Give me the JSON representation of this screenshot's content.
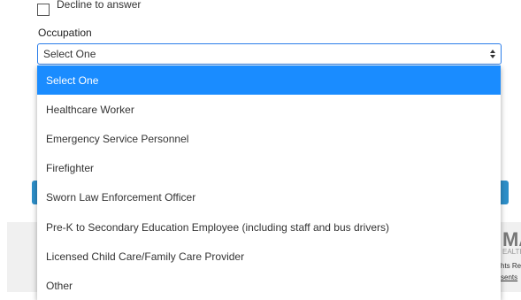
{
  "decline_checkbox": {
    "label": "Decline to answer"
  },
  "occupation": {
    "label": "Occupation",
    "selected_value": "Select One",
    "options": [
      {
        "label": "Select One",
        "selected": true
      },
      {
        "label": "Healthcare Worker",
        "selected": false
      },
      {
        "label": "Emergency Service Personnel",
        "selected": false
      },
      {
        "label": "Firefighter",
        "selected": false
      },
      {
        "label": "Sworn Law Enforcement Officer",
        "selected": false
      },
      {
        "label": "Pre-K to Secondary Education Employee (including staff and bus drivers)",
        "selected": false
      },
      {
        "label": "Licensed Child Care/Family Care Provider",
        "selected": false
      },
      {
        "label": "Other",
        "selected": false
      }
    ]
  },
  "footer": {
    "brand_fragment": "MA",
    "sub_fragment": "EALTH",
    "rights_fragment": "hts Re",
    "consents_fragment": "sents"
  },
  "colors": {
    "highlight": "#1a8cff",
    "select_border": "#2b7de9",
    "button_blue": "#2d8fc9",
    "footer_bg": "#f0f0f0"
  }
}
